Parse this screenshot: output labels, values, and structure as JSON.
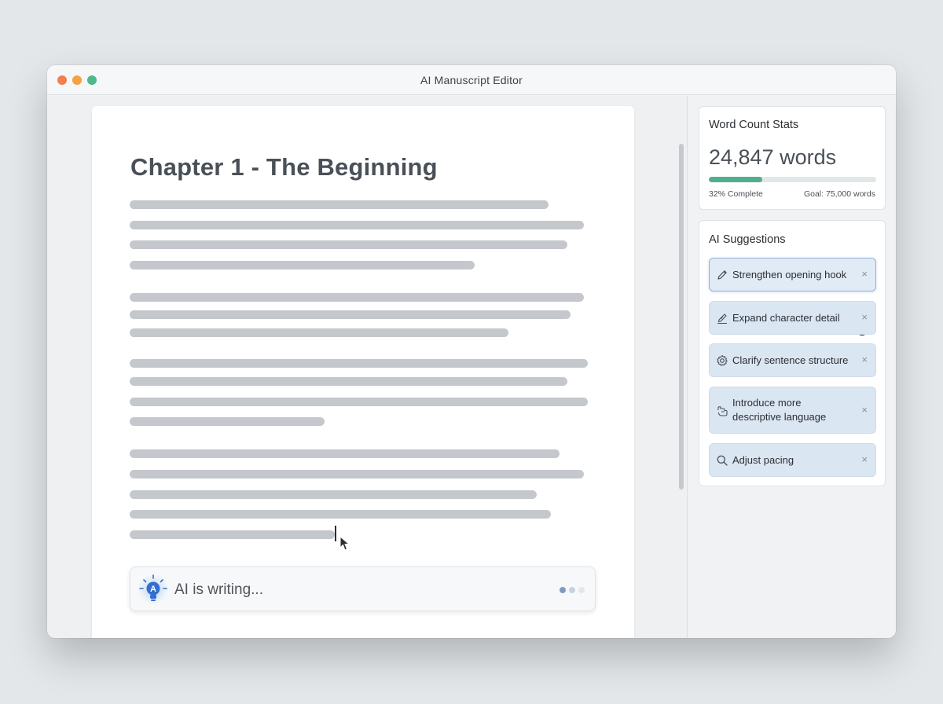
{
  "window": {
    "title": "AI Manuscript Editor"
  },
  "editor": {
    "chapter_title": "Chapter 1 - The Beginning",
    "ai_status": "AI is writing...",
    "ai_badge": "A"
  },
  "stats": {
    "heading": "Word Count Stats",
    "count": "24,847 words",
    "progress_fraction": 0.32,
    "complete_label": "32% Complete",
    "goal_label": "Goal: 75,000 words",
    "accent_color": "#4fae8d"
  },
  "suggestions": {
    "heading": "AI Suggestions",
    "items": [
      {
        "label": "Strengthen opening hook",
        "icon": "pencil-icon",
        "state": "hovered"
      },
      {
        "label": "Expand character detail",
        "icon": "edit-lines-icon"
      },
      {
        "label": "Clarify sentence structure",
        "icon": "gear-icon"
      },
      {
        "label": "Introduce more descriptive language",
        "icon": "hand-icon"
      },
      {
        "label": "Adjust pacing",
        "icon": "search-icon"
      }
    ],
    "close_glyph": "×"
  }
}
